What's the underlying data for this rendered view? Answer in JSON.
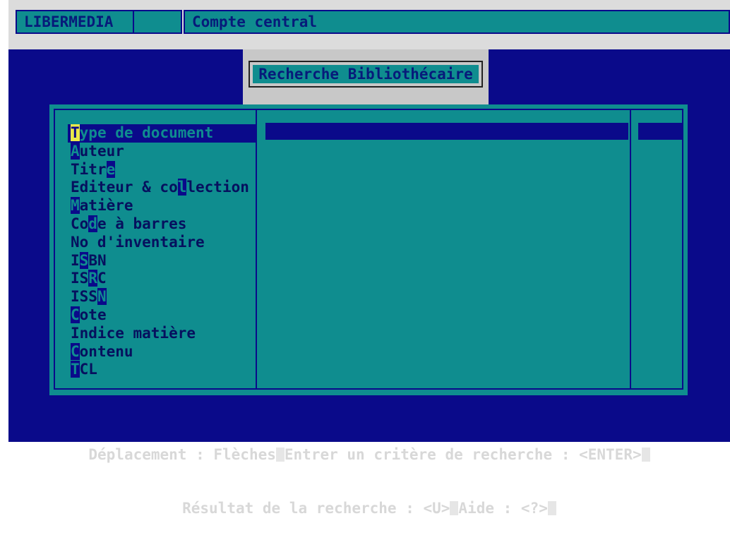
{
  "topbar": {
    "app_name": "LIBERMEDIA",
    "middle": "",
    "account": "Compte central"
  },
  "window": {
    "title": "Recherche Bibliothécaire"
  },
  "menu": {
    "items": [
      {
        "pre": "",
        "hotkey": "T",
        "post": "ype de document",
        "selected": true
      },
      {
        "pre": "",
        "hotkey": "A",
        "post": "uteur"
      },
      {
        "pre": "Titr",
        "hotkey": "e",
        "post": ""
      },
      {
        "pre": "Editeur & co",
        "hotkey": "l",
        "post": "lection"
      },
      {
        "pre": "",
        "hotkey": "M",
        "post": "atière"
      },
      {
        "pre": "Co",
        "hotkey": "d",
        "post": "e à barres"
      },
      {
        "pre": "No d'inventaire",
        "hotkey": "",
        "post": ""
      },
      {
        "pre": "I",
        "hotkey": "S",
        "post": "BN"
      },
      {
        "pre": "IS",
        "hotkey": "R",
        "post": "C"
      },
      {
        "pre": "ISS",
        "hotkey": "N",
        "post": ""
      },
      {
        "pre": "",
        "hotkey": "C",
        "post": "ote"
      },
      {
        "pre": "Indice matière",
        "hotkey": "",
        "post": ""
      },
      {
        "pre": "",
        "hotkey": "C",
        "post": "ontenu"
      },
      {
        "pre": "",
        "hotkey": "T",
        "post": "CL"
      }
    ]
  },
  "footer": {
    "nav_hint": "Déplacement : Flèches",
    "enter_hint": "Entrer un critère de recherche : <ENTER>",
    "result_hint": "Résultat de la recherche : <U>",
    "help_hint": "Aide : <?>"
  },
  "colors": {
    "background": "#0a0a8a",
    "panel": "#0f8d8f",
    "highlight": "#eaea4a",
    "footer_text": "#d8d8d8"
  }
}
